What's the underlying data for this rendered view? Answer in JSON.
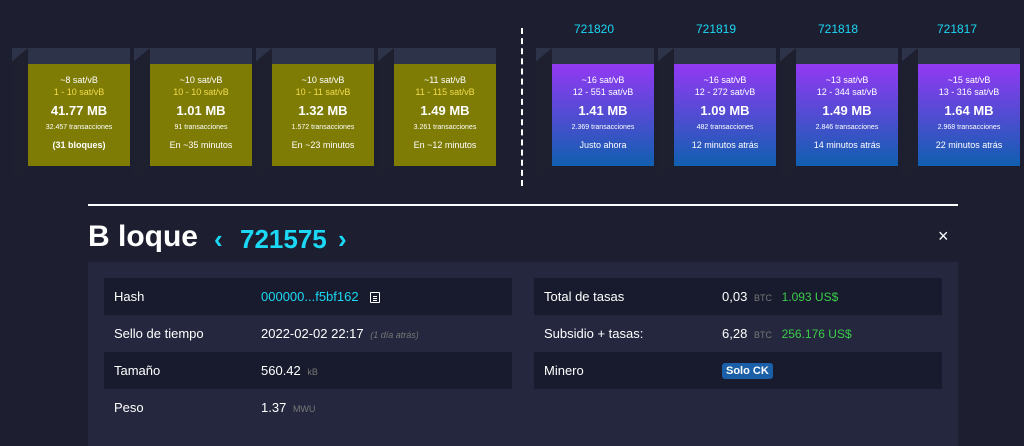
{
  "mempool_blocks": [
    {
      "fee": "~8 sat/vB",
      "range": "1 - 10 sat/vB",
      "size": "41.77 MB",
      "tx": "32.457 transacciones",
      "eta": "(31 bloques)"
    },
    {
      "fee": "~10 sat/vB",
      "range": "10 - 10 sat/vB",
      "size": "1.01 MB",
      "tx": "91 transacciones",
      "eta": "En ~35 minutos"
    },
    {
      "fee": "~10 sat/vB",
      "range": "10 - 11 sat/vB",
      "size": "1.32 MB",
      "tx": "1.572 transacciones",
      "eta": "En ~23 minutos"
    },
    {
      "fee": "~11 sat/vB",
      "range": "11 - 115 sat/vB",
      "size": "1.49 MB",
      "tx": "3.261 transacciones",
      "eta": "En ~12 minutos"
    }
  ],
  "mined_blocks": [
    {
      "height": "721820",
      "fee": "~16 sat/vB",
      "range": "12 - 551 sat/vB",
      "size": "1.41 MB",
      "tx": "2.369 transacciones",
      "time": "Justo ahora"
    },
    {
      "height": "721819",
      "fee": "~16 sat/vB",
      "range": "12 - 272 sat/vB",
      "size": "1.09 MB",
      "tx": "482 transacciones",
      "time": "12 minutos atrás"
    },
    {
      "height": "721818",
      "fee": "~13 sat/vB",
      "range": "12 - 344 sat/vB",
      "size": "1.49 MB",
      "tx": "2.846 transacciones",
      "time": "14 minutos atrás"
    },
    {
      "height": "721817",
      "fee": "~15 sat/vB",
      "range": "13 - 316 sat/vB",
      "size": "1.64 MB",
      "tx": "2.968 transacciones",
      "time": "22 minutos atrás"
    }
  ],
  "header": {
    "title": "B loque",
    "prev_arrow": "‹",
    "block_number": "721575",
    "next_arrow": "›",
    "close": "×"
  },
  "details_left": {
    "hash_label": "Hash",
    "hash_value": "000000...f5bf162",
    "timestamp_label": "Sello de tiempo",
    "timestamp_value": "2022-02-02 22:17",
    "timestamp_relative": "(1 día atrás)",
    "size_label": "Tamaño",
    "size_value": "560.42",
    "size_unit": "kB",
    "weight_label": "Peso",
    "weight_value": "1.37",
    "weight_unit": "MWU"
  },
  "details_right": {
    "fees_label": "Total de tasas",
    "fees_value": "0,03",
    "fees_unit": "BTC",
    "fees_usd": "1.093 US$",
    "subsidy_label": "Subsidio + tasas:",
    "subsidy_value": "6,28",
    "subsidy_unit": "BTC",
    "subsidy_usd": "256.176 US$",
    "miner_label": "Minero",
    "miner_value": "Solo CK"
  },
  "colors": {
    "background": "#1d1f31",
    "accent": "#1bd8f4",
    "mempool_block": "#7f7c06",
    "mined_gradient_top": "#9339f4",
    "mined_gradient_bottom": "#105fb0",
    "usd_green": "#3bcc49",
    "miner_badge": "#1a5fa7"
  }
}
